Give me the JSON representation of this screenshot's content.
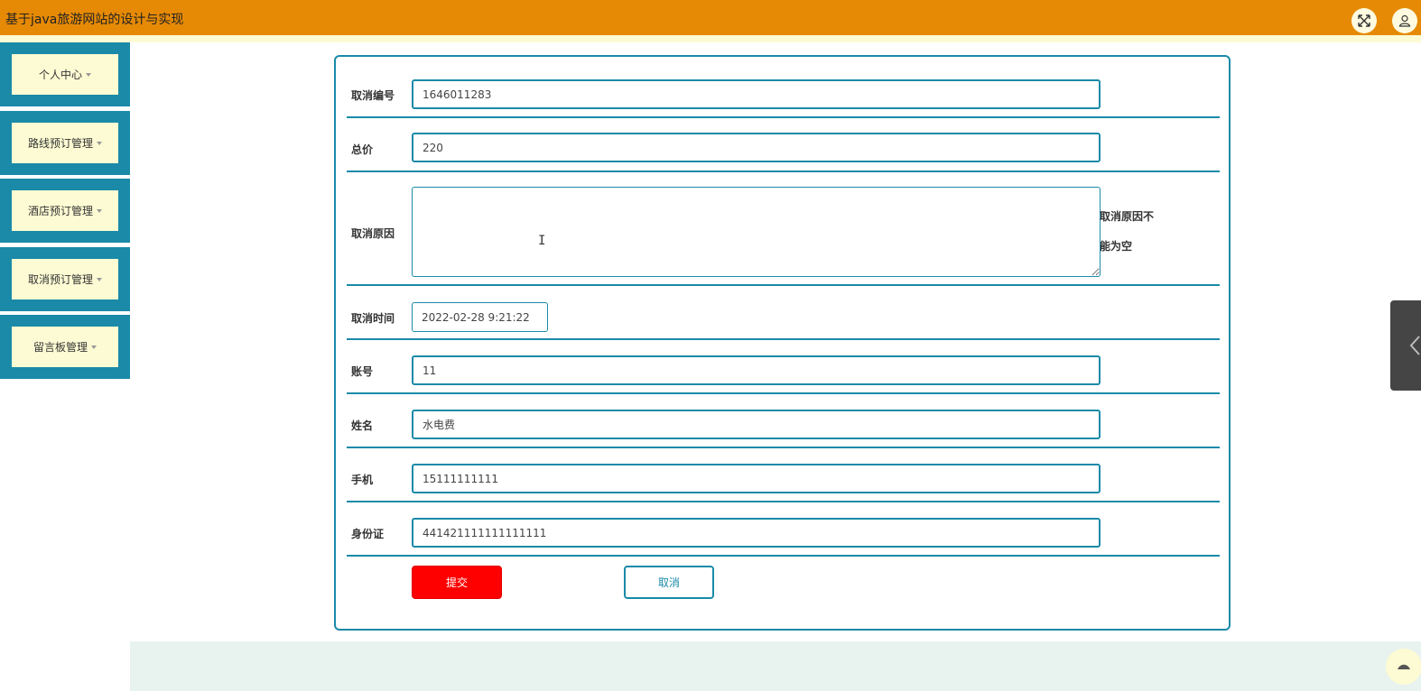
{
  "header": {
    "title": "基于java旅游网站的设计与实现",
    "fullscreen_icon": "expand-icon",
    "user_icon": "user-icon"
  },
  "sidebar": {
    "items": [
      {
        "label": "个人中心"
      },
      {
        "label": "路线预订管理"
      },
      {
        "label": "酒店预订管理"
      },
      {
        "label": "取消预订管理"
      },
      {
        "label": "留言板管理"
      }
    ]
  },
  "form": {
    "fields": {
      "cancel_no": {
        "label": "取消编号",
        "value": "1646011283"
      },
      "total_price": {
        "label": "总价",
        "value": "220"
      },
      "cancel_reason": {
        "label": "取消原因",
        "value": "",
        "error_line1": "取消原因不",
        "error_line2": "能为空"
      },
      "cancel_time": {
        "label": "取消时间",
        "value": "2022-02-28 9:21:22"
      },
      "account": {
        "label": "账号",
        "value": "11"
      },
      "name": {
        "label": "姓名",
        "value": "水电费"
      },
      "phone": {
        "label": "手机",
        "value": "15111111111"
      },
      "id_card": {
        "label": "身份证",
        "value": "441421111111111111"
      }
    },
    "submit_label": "提交",
    "cancel_label": "取消"
  },
  "colors": {
    "header_bg": "#e68a05",
    "accent": "#1a8aa8",
    "sidebar_bg": "#fdfbd3",
    "submit_bg": "#ff0000"
  }
}
